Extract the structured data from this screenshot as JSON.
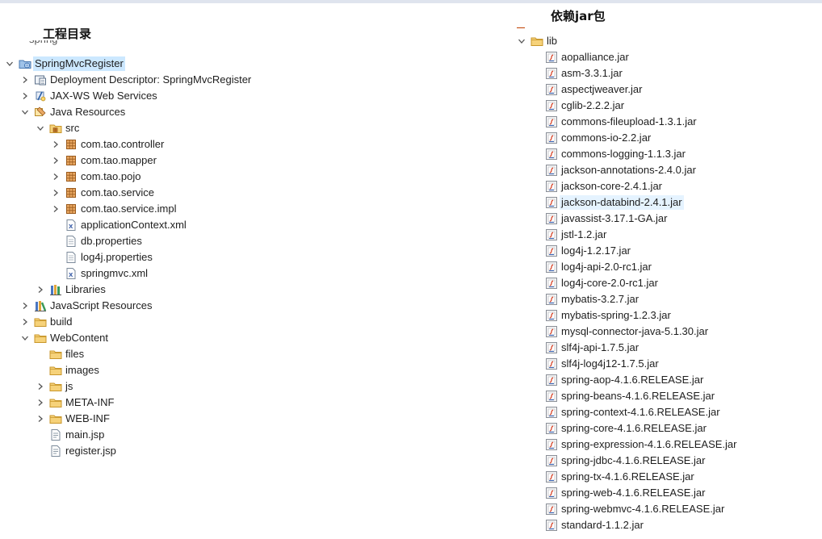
{
  "left_panel": {
    "heading": "工程目录",
    "tree": [
      {
        "label": "SpringMvcRegister",
        "icon": "web-project-icon",
        "depth": 0,
        "twisty": "expanded",
        "selected": true
      },
      {
        "label": "Deployment Descriptor: SpringMvcRegister",
        "icon": "deployment-descriptor-icon",
        "depth": 1,
        "twisty": "collapsed"
      },
      {
        "label": "JAX-WS Web Services",
        "icon": "web-services-icon",
        "depth": 1,
        "twisty": "collapsed"
      },
      {
        "label": "Java Resources",
        "icon": "java-resources-icon",
        "depth": 1,
        "twisty": "expanded"
      },
      {
        "label": "src",
        "icon": "source-folder-icon",
        "depth": 2,
        "twisty": "expanded"
      },
      {
        "label": "com.tao.controller",
        "icon": "package-icon",
        "depth": 3,
        "twisty": "collapsed"
      },
      {
        "label": "com.tao.mapper",
        "icon": "package-icon",
        "depth": 3,
        "twisty": "collapsed"
      },
      {
        "label": "com.tao.pojo",
        "icon": "package-icon",
        "depth": 3,
        "twisty": "collapsed"
      },
      {
        "label": "com.tao.service",
        "icon": "package-icon",
        "depth": 3,
        "twisty": "collapsed"
      },
      {
        "label": "com.tao.service.impl",
        "icon": "package-icon",
        "depth": 3,
        "twisty": "collapsed"
      },
      {
        "label": "applicationContext.xml",
        "icon": "xml-file-icon",
        "depth": 3,
        "twisty": "none"
      },
      {
        "label": "db.properties",
        "icon": "file-icon",
        "depth": 3,
        "twisty": "none"
      },
      {
        "label": "log4j.properties",
        "icon": "file-icon",
        "depth": 3,
        "twisty": "none"
      },
      {
        "label": "springmvc.xml",
        "icon": "xml-file-icon",
        "depth": 3,
        "twisty": "none"
      },
      {
        "label": "Libraries",
        "icon": "libraries-icon",
        "depth": 2,
        "twisty": "collapsed"
      },
      {
        "label": "JavaScript Resources",
        "icon": "javascript-resources-icon",
        "depth": 1,
        "twisty": "collapsed"
      },
      {
        "label": "build",
        "icon": "folder-icon",
        "depth": 1,
        "twisty": "collapsed"
      },
      {
        "label": "WebContent",
        "icon": "folder-icon",
        "depth": 1,
        "twisty": "expanded"
      },
      {
        "label": "files",
        "icon": "folder-icon",
        "depth": 2,
        "twisty": "none"
      },
      {
        "label": "images",
        "icon": "folder-icon",
        "depth": 2,
        "twisty": "none"
      },
      {
        "label": "js",
        "icon": "folder-icon",
        "depth": 2,
        "twisty": "collapsed"
      },
      {
        "label": "META-INF",
        "icon": "folder-icon",
        "depth": 2,
        "twisty": "collapsed"
      },
      {
        "label": "WEB-INF",
        "icon": "folder-icon",
        "depth": 2,
        "twisty": "collapsed"
      },
      {
        "label": "main.jsp",
        "icon": "jsp-file-icon",
        "depth": 2,
        "twisty": "none"
      },
      {
        "label": "register.jsp",
        "icon": "jsp-file-icon",
        "depth": 2,
        "twisty": "none"
      }
    ]
  },
  "right_panel": {
    "heading": "依赖jar包",
    "folder": {
      "label": "lib",
      "icon": "folder-icon",
      "twisty": "expanded"
    },
    "jars": [
      "aopalliance.jar",
      "asm-3.3.1.jar",
      "aspectjweaver.jar",
      "cglib-2.2.2.jar",
      "commons-fileupload-1.3.1.jar",
      "commons-io-2.2.jar",
      "commons-logging-1.1.3.jar",
      "jackson-annotations-2.4.0.jar",
      "jackson-core-2.4.1.jar",
      "jackson-databind-2.4.1.jar",
      "javassist-3.17.1-GA.jar",
      "jstl-1.2.jar",
      "log4j-1.2.17.jar",
      "log4j-api-2.0-rc1.jar",
      "log4j-core-2.0-rc1.jar",
      "mybatis-3.2.7.jar",
      "mybatis-spring-1.2.3.jar",
      "mysql-connector-java-5.1.30.jar",
      "slf4j-api-1.7.5.jar",
      "slf4j-log4j12-1.7.5.jar",
      "spring-aop-4.1.6.RELEASE.jar",
      "spring-beans-4.1.6.RELEASE.jar",
      "spring-context-4.1.6.RELEASE.jar",
      "spring-core-4.1.6.RELEASE.jar",
      "spring-expression-4.1.6.RELEASE.jar",
      "spring-jdbc-4.1.6.RELEASE.jar",
      "spring-tx-4.1.6.RELEASE.jar",
      "spring-web-4.1.6.RELEASE.jar",
      "spring-webmvc-4.1.6.RELEASE.jar",
      "standard-1.1.2.jar"
    ],
    "highlighted_jar": "jackson-databind-2.4.1.jar",
    "jar_icon": "jar-file-icon"
  },
  "colors": {
    "selection": "#cce8ff",
    "hover": "#e5f3ff",
    "folder": "#e8b84a",
    "package": "#b5651d",
    "twisty": "#555555"
  }
}
